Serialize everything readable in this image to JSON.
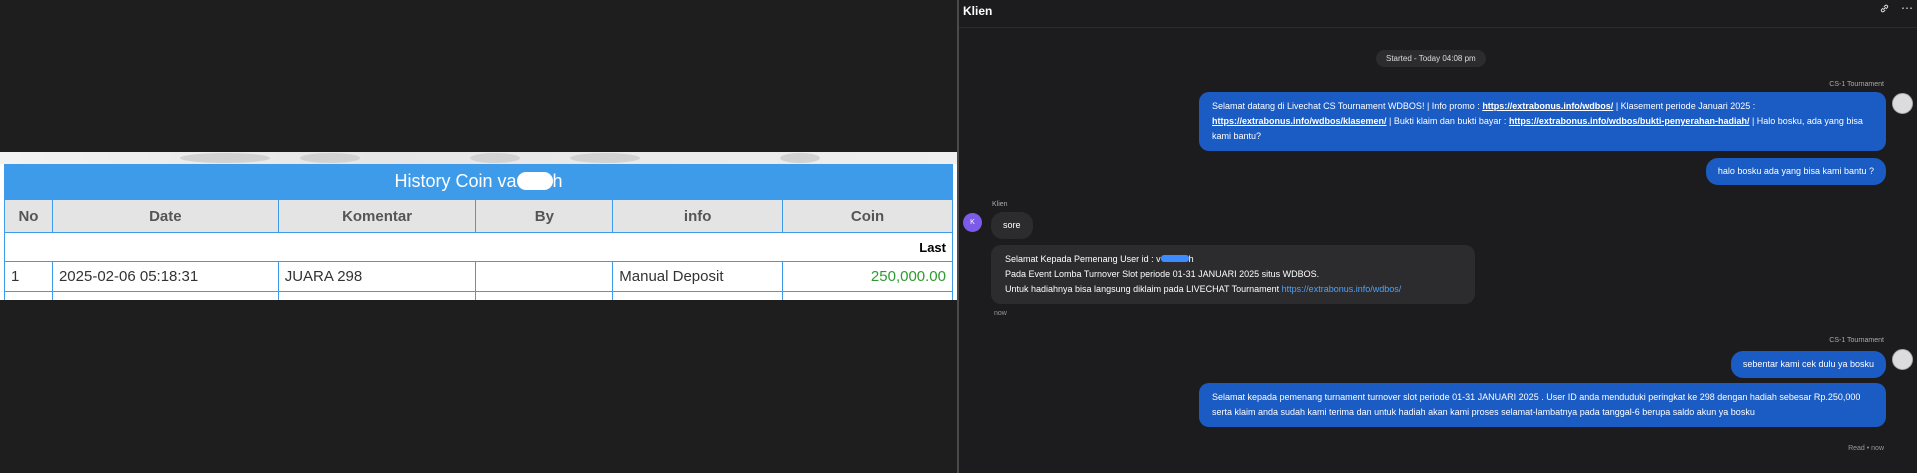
{
  "history": {
    "title": "History Coin va",
    "title_tail": "h",
    "columns": [
      "No",
      "Date",
      "Komentar",
      "By",
      "info",
      "Coin"
    ],
    "subheader_last": "Last",
    "rows": [
      {
        "no": "1",
        "date": "2025-02-06 05:18:31",
        "komentar": "JUARA 298",
        "by": "",
        "info": "Manual Deposit",
        "coin": "250,000.00"
      }
    ]
  },
  "chat": {
    "title": "Klien",
    "header_icons": [
      "link-icon",
      "more-icon"
    ],
    "started": "Started - Today 04:08 pm",
    "agent_name": "CS-1 Tournament",
    "client_name": "Klien",
    "client_avatar_letter": "K",
    "msg1": {
      "t1": "Selamat datang di Livechat CS Tournament WDBOS! | Info promo : ",
      "link1": "https://extrabonus.info/wdbos/",
      "t2": " | Klasement periode Januari 2025 : ",
      "link2": "https://extrabonus.info/wdbos/klasemen/",
      "t3": " | Bukti klaim dan bukti bayar : ",
      "link3": "https://extrabonus.info/wdbos/bukti-penyerahan-hadiah/",
      "t4": " | Halo bosku, ada yang bisa kami bantu?"
    },
    "msg2": "halo bosku ada yang bisa kami bantu ?",
    "msg3": "sore",
    "msg4": {
      "line1_a": "Selamat Kepada Pemenang User id : v",
      "line1_b": "h",
      "line2": "Pada Event Lomba Turnover Slot periode 01-31 JANUARI 2025 situs WDBOS.",
      "line3": "Untuk hadiahnya bisa langsung diklaim pada LIVECHAT Tournament ",
      "link": "https://extrabonus.info/wdbos/"
    },
    "msg4_time": "now",
    "msg5": "sebentar kami cek dulu ya bosku",
    "msg6": "Selamat kepada pemenang turnament turnover slot periode 01-31 JANUARI 2025 . User ID anda menduduki peringkat ke 298 dengan hadiah sebesar Rp.250,000 serta klaim anda sudah kami terima dan untuk hadiah akan kami proses selamat-lambatnya pada tanggal-6 berupa saldo akun ya bosku",
    "read_status": "Read • now"
  },
  "colors": {
    "table_header_blue": "#3d9be9",
    "coin_green": "#2e9b2e",
    "agent_bubble": "#1a5bc4",
    "client_bubble": "#2c2c2e",
    "client_avatar": "#7b5be8"
  }
}
